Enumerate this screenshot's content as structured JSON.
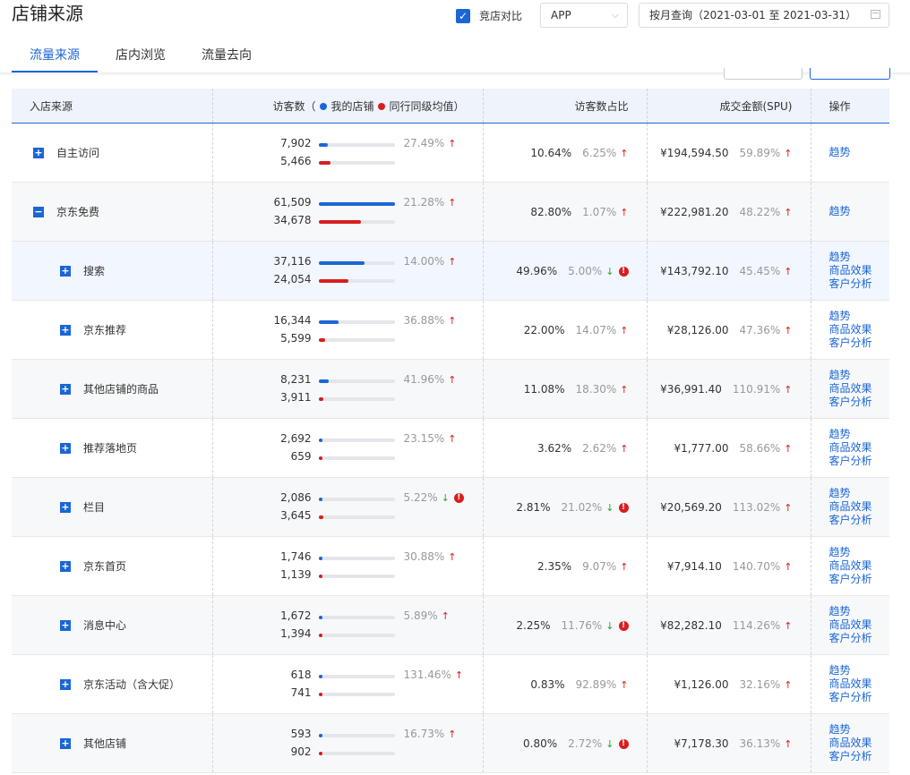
{
  "page": {
    "title": "店铺来源"
  },
  "compare": {
    "label": "竞店对比",
    "checked": true
  },
  "platform_select": {
    "value": "APP"
  },
  "date_range": {
    "text": "按月查询（2021-03-01 至 2021-03-31）"
  },
  "tabs": [
    {
      "label": "流量来源",
      "active": true
    },
    {
      "label": "店内浏览",
      "active": false
    },
    {
      "label": "流量去向",
      "active": false
    }
  ],
  "table": {
    "headers": {
      "source": "入店来源",
      "visitors_prefix": "访客数（",
      "legend_mine": "我的店铺",
      "legend_peer": "同行同级均值",
      "visitors_suffix": "）",
      "share": "访客数占比",
      "gmv": "成交金额(SPU)",
      "ops": "操作"
    },
    "rows": [
      {
        "name": "自主访问",
        "level": 0,
        "toggle": "+",
        "shade": "none",
        "mine": "7,902",
        "peer": "5,466",
        "mine_frac": 0.128,
        "peer_frac": 0.157,
        "vis_pct": "27.49%",
        "vis_trend": "up",
        "vis_warn": false,
        "share": "10.64%",
        "share_pct": "6.25%",
        "share_trend": "up",
        "share_warn": false,
        "gmv": "¥194,594.50",
        "gmv_pct": "59.89%",
        "gmv_trend": "up",
        "ops": [
          "趋势"
        ]
      },
      {
        "name": "京东免费",
        "level": 0,
        "toggle": "−",
        "shade": "grey",
        "mine": "61,509",
        "peer": "34,678",
        "mine_frac": 1.0,
        "peer_frac": 0.564,
        "vis_pct": "21.28%",
        "vis_trend": "up",
        "vis_warn": false,
        "share": "82.80%",
        "share_pct": "1.07%",
        "share_trend": "up",
        "share_warn": false,
        "gmv": "¥222,981.20",
        "gmv_pct": "48.22%",
        "gmv_trend": "up",
        "ops": [
          "趋势"
        ]
      },
      {
        "name": "搜索",
        "level": 1,
        "toggle": "+",
        "shade": "blue",
        "mine": "37,116",
        "peer": "24,054",
        "mine_frac": 0.603,
        "peer_frac": 0.391,
        "vis_pct": "14.00%",
        "vis_trend": "up",
        "vis_warn": false,
        "share": "49.96%",
        "share_pct": "5.00%",
        "share_trend": "down",
        "share_warn": true,
        "gmv": "¥143,792.10",
        "gmv_pct": "45.45%",
        "gmv_trend": "up",
        "ops": [
          "趋势",
          "商品效果",
          "客户分析"
        ]
      },
      {
        "name": "京东推荐",
        "level": 1,
        "toggle": "+",
        "shade": "none",
        "mine": "16,344",
        "peer": "5,599",
        "mine_frac": 0.266,
        "peer_frac": 0.091,
        "vis_pct": "36.88%",
        "vis_trend": "up",
        "vis_warn": false,
        "share": "22.00%",
        "share_pct": "14.07%",
        "share_trend": "up",
        "share_warn": false,
        "gmv": "¥28,126.00",
        "gmv_pct": "47.36%",
        "gmv_trend": "up",
        "ops": [
          "趋势",
          "商品效果",
          "客户分析"
        ]
      },
      {
        "name": "其他店铺的商品",
        "level": 1,
        "toggle": "+",
        "shade": "grey",
        "mine": "8,231",
        "peer": "3,911",
        "mine_frac": 0.134,
        "peer_frac": 0.064,
        "vis_pct": "41.96%",
        "vis_trend": "up",
        "vis_warn": false,
        "share": "11.08%",
        "share_pct": "18.30%",
        "share_trend": "up",
        "share_warn": false,
        "gmv": "¥36,991.40",
        "gmv_pct": "110.91%",
        "gmv_trend": "up",
        "ops": [
          "趋势",
          "商品效果",
          "客户分析"
        ]
      },
      {
        "name": "推荐落地页",
        "level": 1,
        "toggle": "+",
        "shade": "none",
        "mine": "2,692",
        "peer": "659",
        "mine_frac": 0.044,
        "peer_frac": 0.011,
        "vis_pct": "23.15%",
        "vis_trend": "up",
        "vis_warn": false,
        "share": "3.62%",
        "share_pct": "2.62%",
        "share_trend": "up",
        "share_warn": false,
        "gmv": "¥1,777.00",
        "gmv_pct": "58.66%",
        "gmv_trend": "up",
        "ops": [
          "趋势",
          "商品效果",
          "客户分析"
        ]
      },
      {
        "name": "栏目",
        "level": 1,
        "toggle": "+",
        "shade": "grey",
        "mine": "2,086",
        "peer": "3,645",
        "mine_frac": 0.034,
        "peer_frac": 0.059,
        "vis_pct": "5.22%",
        "vis_trend": "down",
        "vis_warn": true,
        "share": "2.81%",
        "share_pct": "21.02%",
        "share_trend": "down",
        "share_warn": true,
        "gmv": "¥20,569.20",
        "gmv_pct": "113.02%",
        "gmv_trend": "up",
        "ops": [
          "趋势",
          "商品效果",
          "客户分析"
        ]
      },
      {
        "name": "京东首页",
        "level": 1,
        "toggle": "+",
        "shade": "none",
        "mine": "1,746",
        "peer": "1,139",
        "mine_frac": 0.028,
        "peer_frac": 0.019,
        "vis_pct": "30.88%",
        "vis_trend": "up",
        "vis_warn": false,
        "share": "2.35%",
        "share_pct": "9.07%",
        "share_trend": "up",
        "share_warn": false,
        "gmv": "¥7,914.10",
        "gmv_pct": "140.70%",
        "gmv_trend": "up",
        "ops": [
          "趋势",
          "商品效果",
          "客户分析"
        ]
      },
      {
        "name": "消息中心",
        "level": 1,
        "toggle": "+",
        "shade": "grey",
        "mine": "1,672",
        "peer": "1,394",
        "mine_frac": 0.027,
        "peer_frac": 0.023,
        "vis_pct": "5.89%",
        "vis_trend": "up",
        "vis_warn": false,
        "share": "2.25%",
        "share_pct": "11.76%",
        "share_trend": "down",
        "share_warn": true,
        "gmv": "¥82,282.10",
        "gmv_pct": "114.26%",
        "gmv_trend": "up",
        "ops": [
          "趋势",
          "商品效果",
          "客户分析"
        ]
      },
      {
        "name": "京东活动（含大促）",
        "level": 1,
        "toggle": "+",
        "shade": "none",
        "mine": "618",
        "peer": "741",
        "mine_frac": 0.01,
        "peer_frac": 0.012,
        "vis_pct": "131.46%",
        "vis_trend": "up",
        "vis_warn": false,
        "share": "0.83%",
        "share_pct": "92.89%",
        "share_trend": "up",
        "share_warn": false,
        "gmv": "¥1,126.00",
        "gmv_pct": "32.16%",
        "gmv_trend": "up",
        "ops": [
          "趋势",
          "商品效果",
          "客户分析"
        ]
      },
      {
        "name": "其他店铺",
        "level": 1,
        "toggle": "+",
        "shade": "grey",
        "mine": "593",
        "peer": "902",
        "mine_frac": 0.01,
        "peer_frac": 0.015,
        "vis_pct": "16.73%",
        "vis_trend": "up",
        "vis_warn": false,
        "share": "0.80%",
        "share_pct": "2.72%",
        "share_trend": "down",
        "share_warn": true,
        "gmv": "¥7,178.30",
        "gmv_pct": "36.13%",
        "gmv_trend": "up",
        "ops": [
          "趋势",
          "商品效果",
          "客户分析"
        ]
      }
    ]
  },
  "icons": {
    "check": "check-icon",
    "chevron": "chevron-down-icon",
    "calendar": "calendar-icon",
    "up": "arrow-up-icon",
    "down": "arrow-down-icon",
    "warn": "warning-icon"
  },
  "colors": {
    "accent": "#1b66d6",
    "mine": "#1b66d6",
    "peer": "#d81e1e",
    "up": "#d81e1e",
    "down": "#2aa52a"
  }
}
